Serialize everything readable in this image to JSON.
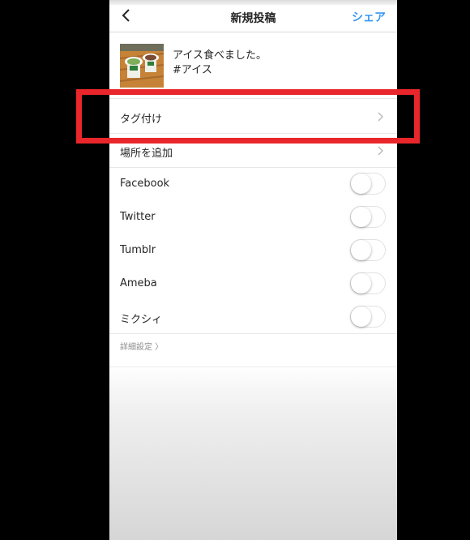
{
  "header": {
    "title": "新規投稿",
    "share_label": "シェア",
    "back_icon": "chevron-left-icon"
  },
  "post": {
    "caption_line1": "アイス食べました。",
    "caption_line2": "#アイス"
  },
  "menu": {
    "tag_label": "タグ付け",
    "location_label": "場所を追加"
  },
  "share_targets": [
    {
      "label": "Facebook",
      "enabled": false
    },
    {
      "label": "Twitter",
      "enabled": false
    },
    {
      "label": "Tumblr",
      "enabled": false
    },
    {
      "label": "Ameba",
      "enabled": false
    },
    {
      "label": "ミクシィ",
      "enabled": false
    }
  ],
  "advanced": {
    "label": "詳細設定 〉"
  },
  "colors": {
    "accent": "#3897f0",
    "highlight": "#e8262b",
    "text": "#262626",
    "muted": "#8e8e8e"
  }
}
